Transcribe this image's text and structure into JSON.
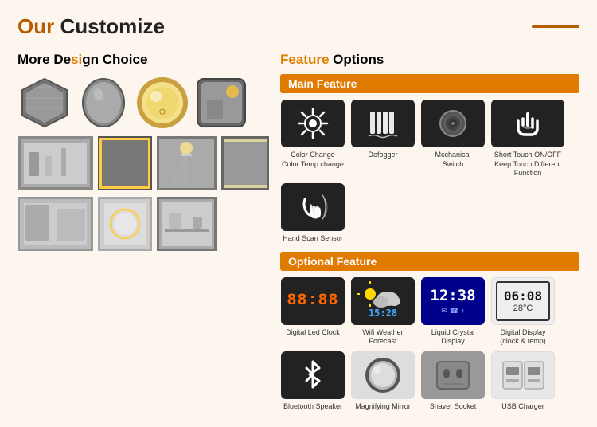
{
  "page": {
    "background": "#fdf6ee"
  },
  "header": {
    "title_our": "Our ",
    "title_customize": "Customize"
  },
  "left": {
    "section_title_more": "More De",
    "section_title_sign": "si",
    "section_title_rest": "gn Choice"
  },
  "right": {
    "section_title_feature": "Feature",
    "section_title_options": " Options",
    "main_feature_label": "Main Feature",
    "optional_feature_label": "Optional Feature",
    "main_features": [
      {
        "label": "Color Change\nColor Temp.change",
        "icon": "color-change"
      },
      {
        "label": "Defogger",
        "icon": "defogger"
      },
      {
        "label": "Mechanical\nSwitch",
        "icon": "mechanical-switch"
      },
      {
        "label": "Short Touch ON/OFF\nKeep Touch Different\nFunction",
        "icon": "touch-sensor"
      },
      {
        "label": "Hand Scan Sensor",
        "icon": "hand-scan"
      }
    ],
    "optional_features": [
      {
        "label": "Digital Led Clock",
        "icon": "digital-clock"
      },
      {
        "label": "Wifi Weather Forecast",
        "icon": "weather"
      },
      {
        "label": "Liquid Crystal Display",
        "icon": "lcd"
      },
      {
        "label": "Digital Display\n(clock & temp)",
        "icon": "digital-display"
      },
      {
        "label": "Bluetooth Speaker",
        "icon": "bluetooth"
      },
      {
        "label": "Magnifying Mirror",
        "icon": "magnifying"
      },
      {
        "label": "Shaver Socket",
        "icon": "shaver"
      },
      {
        "label": "USB Charger",
        "icon": "usb"
      }
    ]
  }
}
